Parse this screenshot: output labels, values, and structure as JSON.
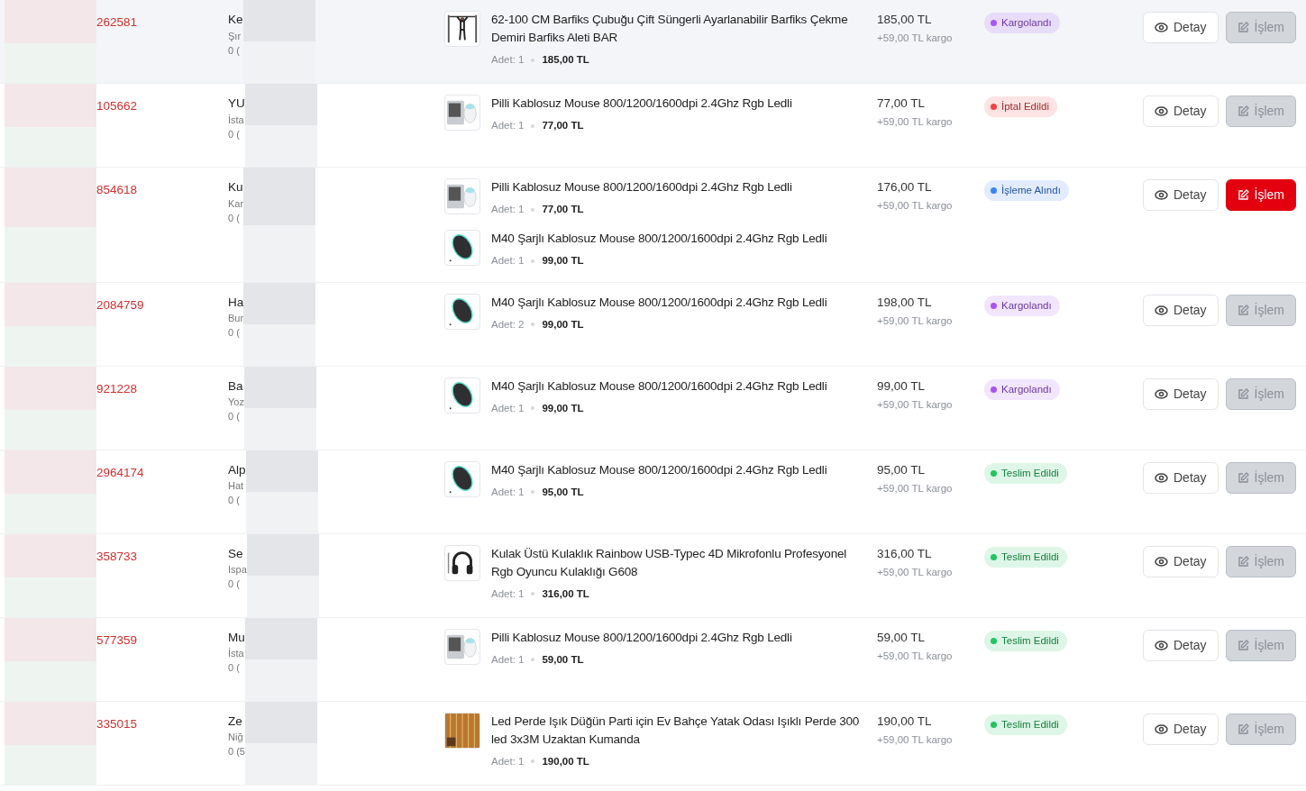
{
  "orders": [
    {
      "order_no": "262581",
      "highlighted": true,
      "customer": {
        "name": "Ke",
        "city": "Şır",
        "phone": "0 ("
      },
      "items": [
        {
          "title": "62-100 CM Barfiks Çubuğu Çift Süngerli Ayarlanabilir Barfiks Çekme Demiri Barfiks Aleti BAR",
          "kind": "bar",
          "qty": "Adet: 1",
          "unit_price": "185,00 TL"
        }
      ],
      "total": "185,00 TL",
      "shipping": "+59,00 TL kargo",
      "status": {
        "label": "Kargolandı",
        "color": "#a855f7"
      },
      "detail_button": "Detay",
      "action_button": {
        "label": "İşlem",
        "disabled": true
      }
    },
    {
      "order_no": "105662",
      "highlighted": false,
      "customer": {
        "name": "YU",
        "city": "İsta",
        "phone": "0 ("
      },
      "items": [
        {
          "title": "Pilli Kablosuz Mouse 800/1200/1600dpi 2.4Ghz Rgb Ledli",
          "kind": "keyboard-mouse",
          "qty": "Adet: 1",
          "unit_price": "77,00 TL"
        }
      ],
      "total": "77,00 TL",
      "shipping": "+59,00 TL kargo",
      "status": {
        "label": "İptal Edildi",
        "color": "#ef4444"
      },
      "detail_button": "Detay",
      "action_button": {
        "label": "İşlem",
        "disabled": true
      }
    },
    {
      "order_no": "854618",
      "highlighted": false,
      "customer": {
        "name": "Ku",
        "city": "Kar",
        "phone": "0 ("
      },
      "items": [
        {
          "title": "Pilli Kablosuz Mouse 800/1200/1600dpi 2.4Ghz Rgb Ledli",
          "kind": "keyboard-mouse",
          "qty": "Adet: 1",
          "unit_price": "77,00 TL"
        },
        {
          "title": "M40 Şarjlı Kablosuz Mouse 800/1200/1600dpi 2.4Ghz Rgb Ledli",
          "kind": "mouse",
          "qty": "Adet: 1",
          "unit_price": "99,00 TL"
        }
      ],
      "total": "176,00 TL",
      "shipping": "+59,00 TL kargo",
      "status": {
        "label": "İşleme Alındı",
        "color": "#3b82f6"
      },
      "detail_button": "Detay",
      "action_button": {
        "label": "İşlem",
        "disabled": false
      }
    },
    {
      "order_no": "2084759",
      "highlighted": false,
      "customer": {
        "name": "Ha",
        "city": "Bur",
        "phone": "0 ("
      },
      "items": [
        {
          "title": "M40 Şarjlı Kablosuz Mouse 800/1200/1600dpi 2.4Ghz Rgb Ledli",
          "kind": "mouse",
          "qty": "Adet: 2",
          "unit_price": "99,00 TL"
        }
      ],
      "total": "198,00 TL",
      "shipping": "+59,00 TL kargo",
      "status": {
        "label": "Kargolandı",
        "color": "#a855f7"
      },
      "detail_button": "Detay",
      "action_button": {
        "label": "İşlem",
        "disabled": true
      }
    },
    {
      "order_no": "921228",
      "highlighted": false,
      "customer": {
        "name": "Ba",
        "city": "Yoz",
        "phone": "0 ("
      },
      "items": [
        {
          "title": "M40 Şarjlı Kablosuz Mouse 800/1200/1600dpi 2.4Ghz Rgb Ledli",
          "kind": "mouse",
          "qty": "Adet: 1",
          "unit_price": "99,00 TL"
        }
      ],
      "total": "99,00 TL",
      "shipping": "+59,00 TL kargo",
      "status": {
        "label": "Kargolandı",
        "color": "#a855f7"
      },
      "detail_button": "Detay",
      "action_button": {
        "label": "İşlem",
        "disabled": true
      }
    },
    {
      "order_no": "2964174",
      "highlighted": false,
      "customer": {
        "name": "Alp",
        "city": "Hat",
        "phone": "0 ("
      },
      "items": [
        {
          "title": "M40 Şarjlı Kablosuz Mouse 800/1200/1600dpi 2.4Ghz Rgb Ledli",
          "kind": "mouse",
          "qty": "Adet: 1",
          "unit_price": "95,00 TL"
        }
      ],
      "total": "95,00 TL",
      "shipping": "+59,00 TL kargo",
      "status": {
        "label": "Teslim Edildi",
        "color": "#22c55e"
      },
      "detail_button": "Detay",
      "action_button": {
        "label": "İşlem",
        "disabled": true
      }
    },
    {
      "order_no": "358733",
      "highlighted": false,
      "customer": {
        "name": "Se",
        "city": "Ispa",
        "phone": "0 ("
      },
      "items": [
        {
          "title": "Kulak Üstü Kulaklık Rainbow USB-Typec 4D Mikrofonlu Profesyonel Rgb Oyuncu Kulaklığı G608",
          "kind": "headset",
          "qty": "Adet: 1",
          "unit_price": "316,00 TL"
        }
      ],
      "total": "316,00 TL",
      "shipping": "+59,00 TL kargo",
      "status": {
        "label": "Teslim Edildi",
        "color": "#22c55e"
      },
      "detail_button": "Detay",
      "action_button": {
        "label": "İşlem",
        "disabled": true
      }
    },
    {
      "order_no": "577359",
      "highlighted": false,
      "customer": {
        "name": "Mu",
        "city": "İsta",
        "phone": "0 ("
      },
      "items": [
        {
          "title": "Pilli Kablosuz Mouse 800/1200/1600dpi 2.4Ghz Rgb Ledli",
          "kind": "keyboard-mouse",
          "qty": "Adet: 1",
          "unit_price": "59,00 TL"
        }
      ],
      "total": "59,00 TL",
      "shipping": "+59,00 TL kargo",
      "status": {
        "label": "Teslim Edildi",
        "color": "#22c55e"
      },
      "detail_button": "Detay",
      "action_button": {
        "label": "İşlem",
        "disabled": true
      }
    },
    {
      "order_no": "335015",
      "highlighted": false,
      "customer": {
        "name": "Ze",
        "city": "Niğ",
        "phone": "0 (5"
      },
      "items": [
        {
          "title": "Led Perde Işık Düğün Parti için Ev Bahçe Yatak Odası Işıklı Perde 300 led 3x3M Uzaktan Kumanda",
          "kind": "lights",
          "qty": "Adet: 1",
          "unit_price": "190,00 TL"
        }
      ],
      "total": "190,00 TL",
      "shipping": "+59,00 TL kargo",
      "status": {
        "label": "Teslim Edildi",
        "color": "#22c55e"
      },
      "detail_button": "Detay",
      "action_button": {
        "label": "İşlem",
        "disabled": true
      }
    }
  ]
}
